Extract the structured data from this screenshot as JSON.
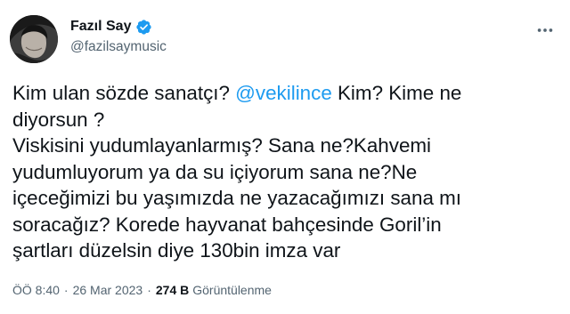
{
  "author": {
    "display_name": "Fazıl Say",
    "handle": "@fazilsaymusic",
    "verified": true
  },
  "tweet": {
    "lines": [
      {
        "parts": [
          {
            "text": "Kim ulan sözde sanatçı? "
          },
          {
            "text": "@vekilince",
            "mention": true
          },
          {
            "text": "  Kim? Kime ne"
          }
        ]
      },
      {
        "parts": [
          {
            "text": "diyorsun ?"
          }
        ]
      },
      {
        "parts": [
          {
            "text": "Viskisini yudumlayanlarmış? Sana ne?Kahvemi"
          }
        ]
      },
      {
        "parts": [
          {
            "text": "yudumluyorum ya da su içiyorum sana ne?Ne"
          }
        ]
      },
      {
        "parts": [
          {
            "text": "içeceğimizi bu yaşımızda ne yazacağımızı sana mı"
          }
        ]
      },
      {
        "parts": [
          {
            "text": "soracağız? Korede hayvanat bahçesinde Goril’in"
          }
        ]
      },
      {
        "parts": [
          {
            "text": "şartları düzelsin diye 130bin imza var"
          }
        ]
      }
    ]
  },
  "meta": {
    "time": "ÖÖ 8:40",
    "separator": "·",
    "date": "26 Mar 2023",
    "views_count": "274 B",
    "views_label": "Görüntülenme"
  },
  "colors": {
    "mention": "#1d9bf0",
    "verified_badge": "#1d9bf0",
    "secondary_text": "#536471"
  },
  "icons": {
    "verified": "verified-badge-icon",
    "more": "more-options-icon"
  }
}
